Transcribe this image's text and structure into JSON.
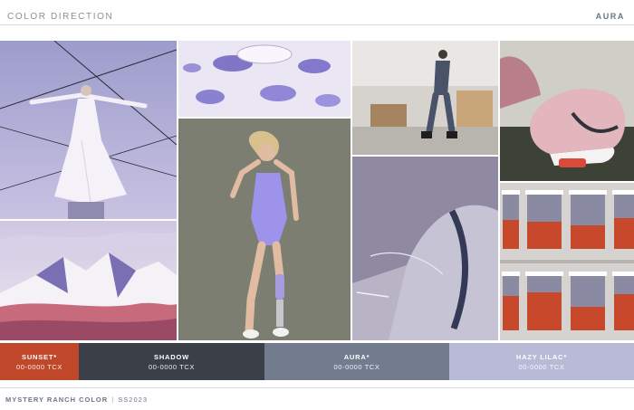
{
  "header": {
    "title": "COLOR DIRECTION",
    "right_label": "AURA"
  },
  "swatches": [
    {
      "name": "SUNSET*",
      "code": "00-0000 TCX",
      "color": "#c0472a"
    },
    {
      "name": "SHADOW",
      "code": "00-0000 TCX",
      "color": "#3b4048"
    },
    {
      "name": "AURA*",
      "code": "00-0000 TCX",
      "color": "#727c8e"
    },
    {
      "name": "HAZY LILAC*",
      "code": "00-0000 TCX",
      "color": "#b8bad8"
    }
  ],
  "footer": {
    "brand": "MYSTERY RANCH COLOR",
    "season": "SS2023"
  }
}
